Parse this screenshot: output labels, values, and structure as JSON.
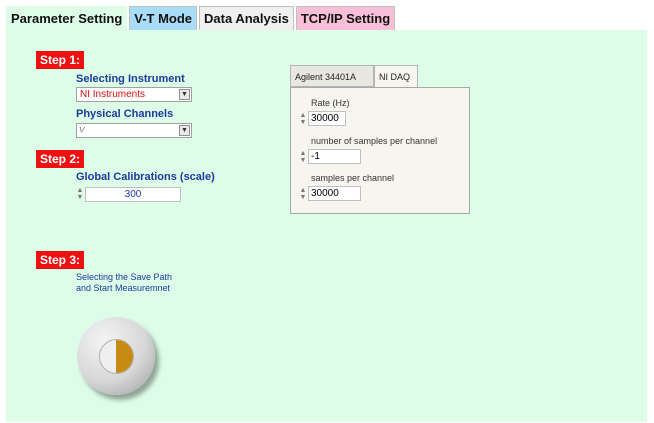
{
  "tabs": [
    {
      "label": "Parameter Setting"
    },
    {
      "label": "V-T Mode"
    },
    {
      "label": "Data Analysis"
    },
    {
      "label": "TCP/IP Setting"
    }
  ],
  "step1": {
    "badge": "Step 1:",
    "instrument_label": "Selecting Instrument",
    "instrument_value": "NI Instruments",
    "channels_label": "Physical Channels",
    "channels_value": ""
  },
  "step2": {
    "badge": "Step 2:",
    "calib_label": "Global Calibrations (scale)",
    "calib_value": "300"
  },
  "step3": {
    "badge": "Step 3:",
    "description_line1": "Selecting the Save Path",
    "description_line2": "and Start Measuremnet"
  },
  "daq": {
    "tabs": [
      {
        "label": "Agilent 34401A"
      },
      {
        "label": "NI DAQ"
      }
    ],
    "rate_label": "Rate (Hz)",
    "rate_value": "30000",
    "samples_label": "number of samples per channel",
    "samples_value": "-1",
    "spc_label": "samples per channel",
    "spc_value": "30000"
  },
  "colors": {
    "panel_bg": "#ddfde8",
    "step_badge": "#ee1111",
    "label_blue": "#1c3a9c",
    "button_center": "#c78a12"
  }
}
